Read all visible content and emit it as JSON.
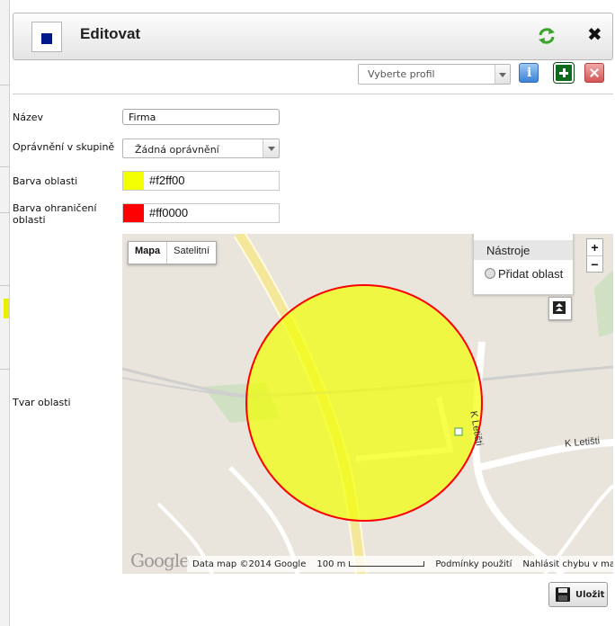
{
  "dialog": {
    "title": "Editovat",
    "icons": {
      "header": "square-icon",
      "refresh": "refresh-icon",
      "close": "close-icon"
    }
  },
  "toolbar": {
    "profile_placeholder": "Vyberte profil",
    "icons": {
      "info": "info-icon",
      "add": "add-icon",
      "delete": "delete-icon"
    }
  },
  "form": {
    "name_label": "Název",
    "name_value": "Firma",
    "permission_label": "Oprávnění v skupině",
    "permission_value": "Žádná oprávnění",
    "area_color_label": "Barva oblasti",
    "area_color_value": "#f2ff00",
    "border_color_label": "Barva ohraničení oblasti",
    "border_color_value": "#ff0000",
    "shape_label": "Tvar oblasti"
  },
  "map": {
    "type_map": "Mapa",
    "type_satellite": "Satelitní",
    "tools_title": "Nástroje",
    "tools_add_area": "Přidat oblast",
    "zoom_in": "+",
    "zoom_out": "−",
    "street_k_letisti_1": "K Letišti",
    "street_k_letisti_2": "K Letišti",
    "logo_text": "Google",
    "footer_data": "Data map ©2014 Google",
    "footer_scale": "100 m",
    "footer_terms": "Podmínky použití",
    "footer_report": "Nahlásit chybu v mapě",
    "colors": {
      "fill": "#f2ff00",
      "stroke": "#ff0000",
      "land": "#e9e5dc",
      "road": "#ffffff"
    }
  },
  "actions": {
    "save_label": "Uložit",
    "icons": {
      "save": "floppy-icon"
    }
  }
}
